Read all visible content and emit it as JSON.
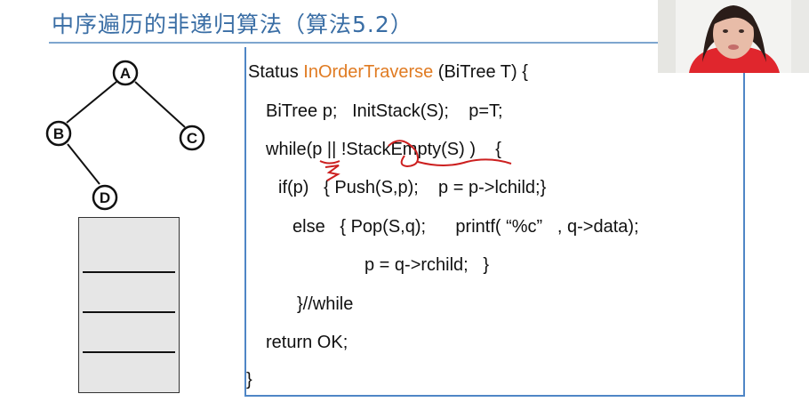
{
  "slide": {
    "title": "中序遍历的非递归算法（算法5.2）"
  },
  "tree": {
    "nodes": [
      "A",
      "B",
      "C",
      "D"
    ]
  },
  "code": {
    "line1_prefix": "Status ",
    "line1_fn": "InOrderTraverse",
    "line1_suffix": " (BiTree T) {",
    "line2": "BiTree p;   InitStack(S);    p=T;",
    "line3": "while(p || !StackEmpty(S) )    {",
    "line4": "if(p)   { Push(S,p);    p = p->lchild;}",
    "line5": "else   { Pop(S,q);      printf( “%c”   , q->data);",
    "line6": "p = q->rchild;   }",
    "line7": "}//while",
    "line8": "return OK;",
    "line9": "}"
  },
  "colors": {
    "title": "#3a6ea5",
    "function_name": "#e07b22",
    "code_box_border": "#4f86c6",
    "annotation_ink": "#cc1f1f"
  },
  "icons": {
    "webcam": "presenter-webcam-overlay"
  }
}
